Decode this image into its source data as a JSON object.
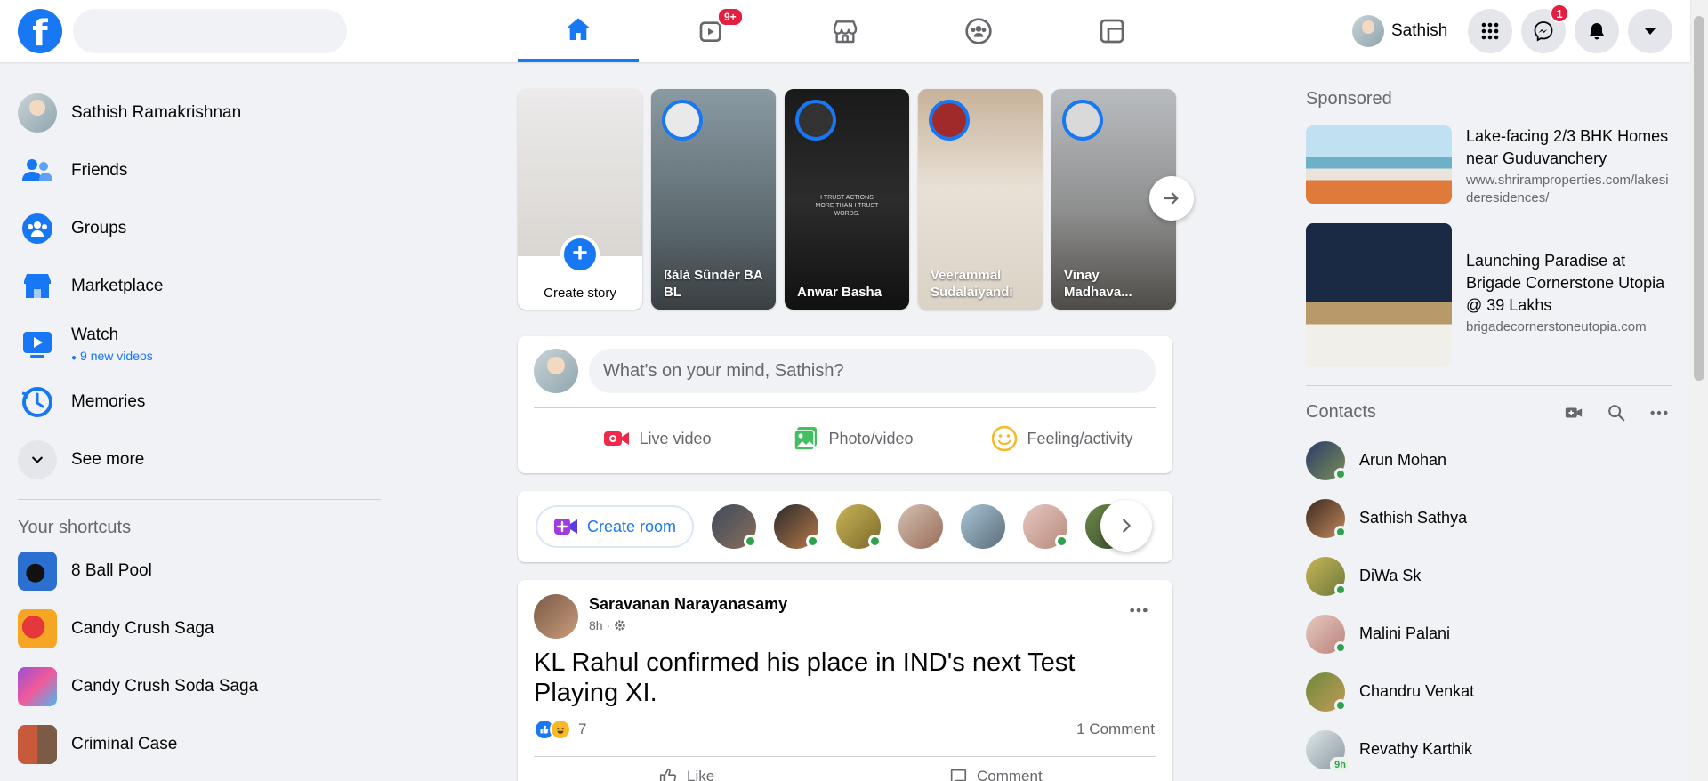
{
  "topbar": {
    "search_placeholder": "",
    "watch_badge": "9+",
    "profile_name": "Sathish",
    "messenger_badge": "1"
  },
  "sidebar": {
    "items": [
      {
        "label": "Sathish Ramakrishnan"
      },
      {
        "label": "Friends"
      },
      {
        "label": "Groups"
      },
      {
        "label": "Marketplace"
      },
      {
        "label": "Watch",
        "sub": "9 new videos"
      },
      {
        "label": "Memories"
      },
      {
        "label": "See more"
      }
    ],
    "shortcuts_title": "Your shortcuts",
    "shortcuts": [
      {
        "label": "8 Ball Pool"
      },
      {
        "label": "Candy Crush Saga"
      },
      {
        "label": "Candy Crush Soda Saga"
      },
      {
        "label": "Criminal Case"
      }
    ]
  },
  "stories": {
    "create_label": "Create story",
    "items": [
      {
        "name": "ßálà Sûndèr BA BL"
      },
      {
        "name": "Anwar Basha",
        "overlay": "I TRUST ACTIONS MORE THAN I TRUST WORDS."
      },
      {
        "name": "Veerammal Sudalaiyandi"
      },
      {
        "name": "Vinay Madhava..."
      }
    ]
  },
  "composer": {
    "placeholder": "What's on your mind, Sathish?",
    "actions": {
      "live": "Live video",
      "photo": "Photo/video",
      "feeling": "Feeling/activity"
    }
  },
  "rooms": {
    "create_label": "Create room"
  },
  "post": {
    "author": "Saravanan Narayanasamy",
    "time": "8h ·",
    "text": "KL Rahul confirmed his place in IND's next Test Playing XI.",
    "reaction_count": "7",
    "comments": "1 Comment",
    "like_label": "Like",
    "comment_label": "Comment"
  },
  "right": {
    "sponsored_title": "Sponsored",
    "ads": [
      {
        "title": "Lake-facing 2/3 BHK Homes near Guduvanchery",
        "url": "www.shriramproperties.com/lakesideresidences/"
      },
      {
        "title": "Launching Paradise at Brigade Cornerstone Utopia @ 39 Lakhs",
        "url": "brigadecornerstoneutopia.com"
      }
    ],
    "contacts_title": "Contacts",
    "contacts": [
      {
        "name": "Arun Mohan"
      },
      {
        "name": "Sathish Sathya"
      },
      {
        "name": "DiWa Sk"
      },
      {
        "name": "Malini Palani"
      },
      {
        "name": "Chandru Venkat"
      },
      {
        "name": "Revathy Karthik",
        "ago": "9h"
      }
    ]
  },
  "colors": {
    "brand": "#1877f2",
    "online": "#31a24c",
    "badge": "#e41e3f",
    "background": "#f0f2f5"
  }
}
